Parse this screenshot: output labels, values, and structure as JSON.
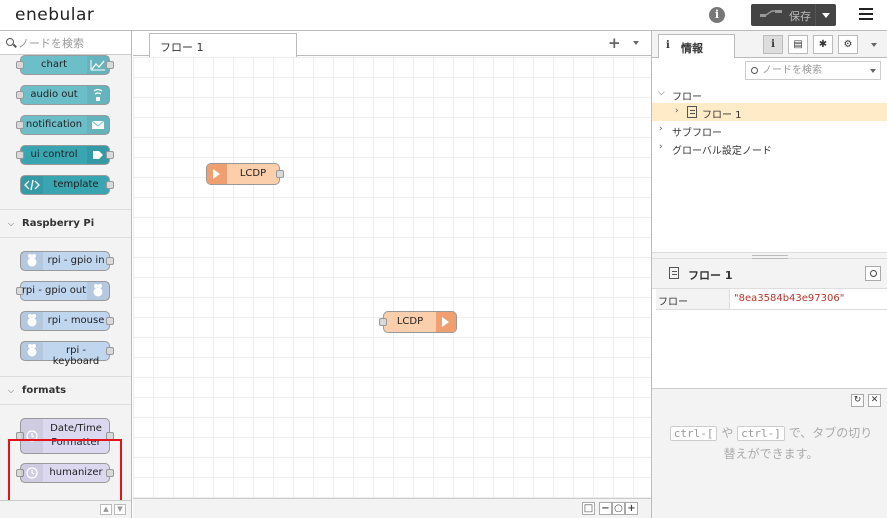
{
  "header": {
    "logo": "enebular",
    "save_label": "保存",
    "colors": {
      "save_bg": "#444444"
    }
  },
  "palette": {
    "search_placeholder": "ノードを検索",
    "dashboard_nodes": [
      {
        "label": "chart",
        "icon": "chart-icon"
      },
      {
        "label": "audio out",
        "icon": "audio-icon"
      },
      {
        "label": "notification",
        "icon": "envelope-icon"
      },
      {
        "label": "ui control",
        "icon": "arrow-icon"
      },
      {
        "label": "template",
        "icon": "code-icon"
      }
    ],
    "categories": {
      "raspberry_pi": "Raspberry Pi",
      "formats": "formats"
    },
    "rpi_nodes": [
      {
        "label": "rpi - gpio in"
      },
      {
        "label": "rpi - gpio out"
      },
      {
        "label": "rpi - mouse"
      },
      {
        "label": "rpi - keyboard"
      }
    ],
    "format_nodes": [
      {
        "label_line1": "Date/Time",
        "label_line2": "Formatter"
      },
      {
        "label": "humanizer"
      }
    ]
  },
  "workspace": {
    "tab_label": "フロー 1",
    "nodes": [
      {
        "label": "LCDP",
        "type": "input"
      },
      {
        "label": "LCDP",
        "type": "output"
      }
    ]
  },
  "sidebar": {
    "tab_label": "情報",
    "search_placeholder": "ノードを検索",
    "tree": {
      "flows": "フロー",
      "flow1": "フロー 1",
      "subflows": "サブフロー",
      "global_config": "グローバル設定ノード"
    },
    "info": {
      "title": "フロー 1",
      "prop_key": "フロー",
      "prop_value": "\"8ea3584b43e97306\""
    },
    "tip": {
      "key1": "ctrl-[",
      "sep": "や",
      "key2": "ctrl-]",
      "text": "で、タブの切り替えができます。"
    }
  }
}
